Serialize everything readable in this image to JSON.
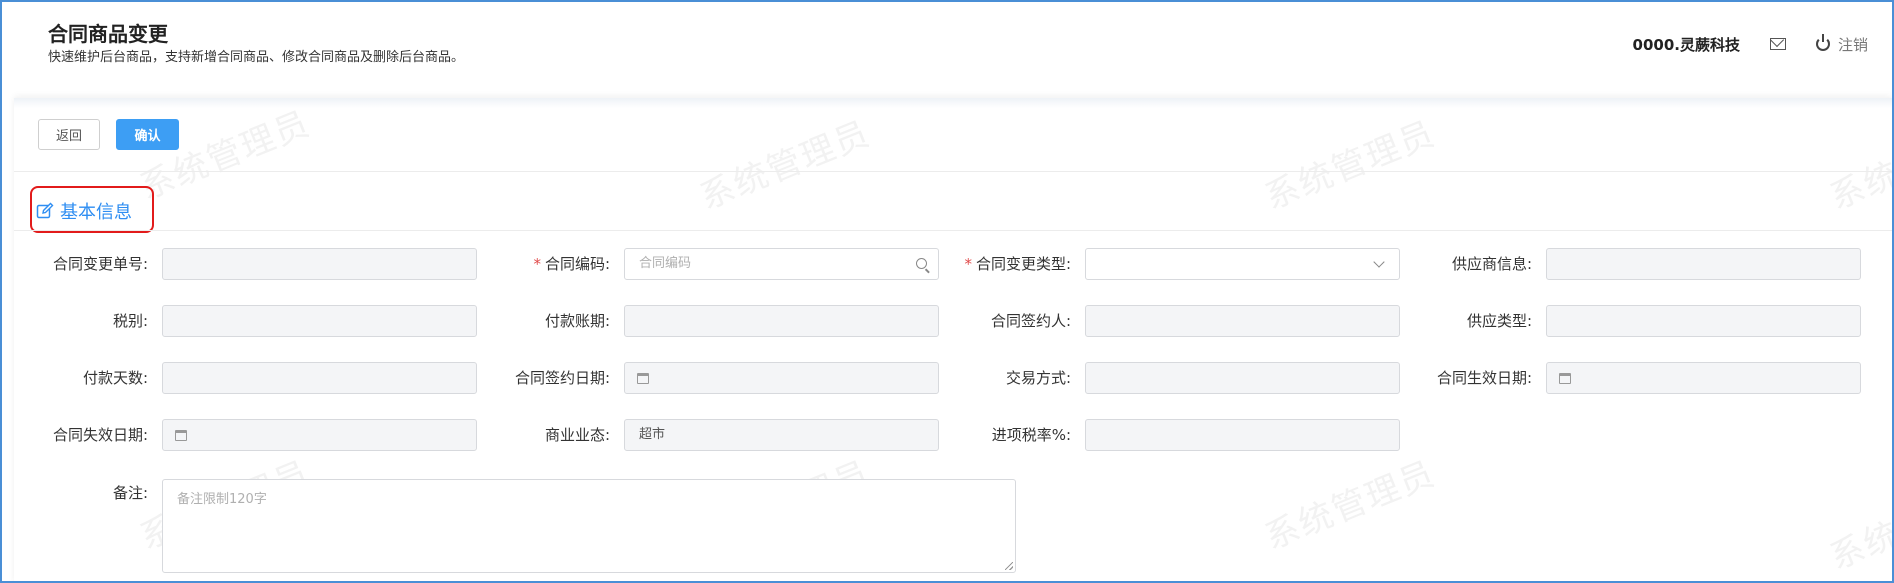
{
  "header": {
    "title": "合同商品变更",
    "subtitle": "快速维护后台商品，支持新增合同商品、修改合同商品及删除后台商品。",
    "org": "0000.灵蕨科技",
    "logout_label": "注销"
  },
  "toolbar": {
    "back_label": "返回",
    "confirm_label": "确认"
  },
  "section": {
    "title": "基本信息"
  },
  "watermark": "系统管理员",
  "form": {
    "change_no": {
      "label": "合同变更单号:",
      "value": ""
    },
    "contract_code": {
      "label": "合同编码:",
      "placeholder": "合同编码",
      "required": true
    },
    "change_type": {
      "label": "合同变更类型:",
      "value": "",
      "required": true
    },
    "supplier_info": {
      "label": "供应商信息:",
      "value": ""
    },
    "tax_type": {
      "label": "税别:",
      "value": ""
    },
    "payment_account": {
      "label": "付款账期:",
      "value": ""
    },
    "signer": {
      "label": "合同签约人:",
      "value": ""
    },
    "supply_type": {
      "label": "供应类型:",
      "value": ""
    },
    "payment_days": {
      "label": "付款天数:",
      "value": ""
    },
    "sign_date": {
      "label": "合同签约日期:",
      "value": ""
    },
    "trade_mode": {
      "label": "交易方式:",
      "value": ""
    },
    "effective_date": {
      "label": "合同生效日期:",
      "value": ""
    },
    "expiry_date": {
      "label": "合同失效日期:",
      "value": ""
    },
    "business_format": {
      "label": "商业业态:",
      "value": "超市"
    },
    "input_tax_rate": {
      "label": "进项税率%:",
      "value": ""
    },
    "remarks": {
      "label": "备注:",
      "placeholder": "备注限制120字"
    }
  },
  "colors": {
    "accent": "#3d9ef4",
    "section_title": "#2f8ef2",
    "required": "#e04a4a",
    "highlight_box": "#e21b1b"
  }
}
